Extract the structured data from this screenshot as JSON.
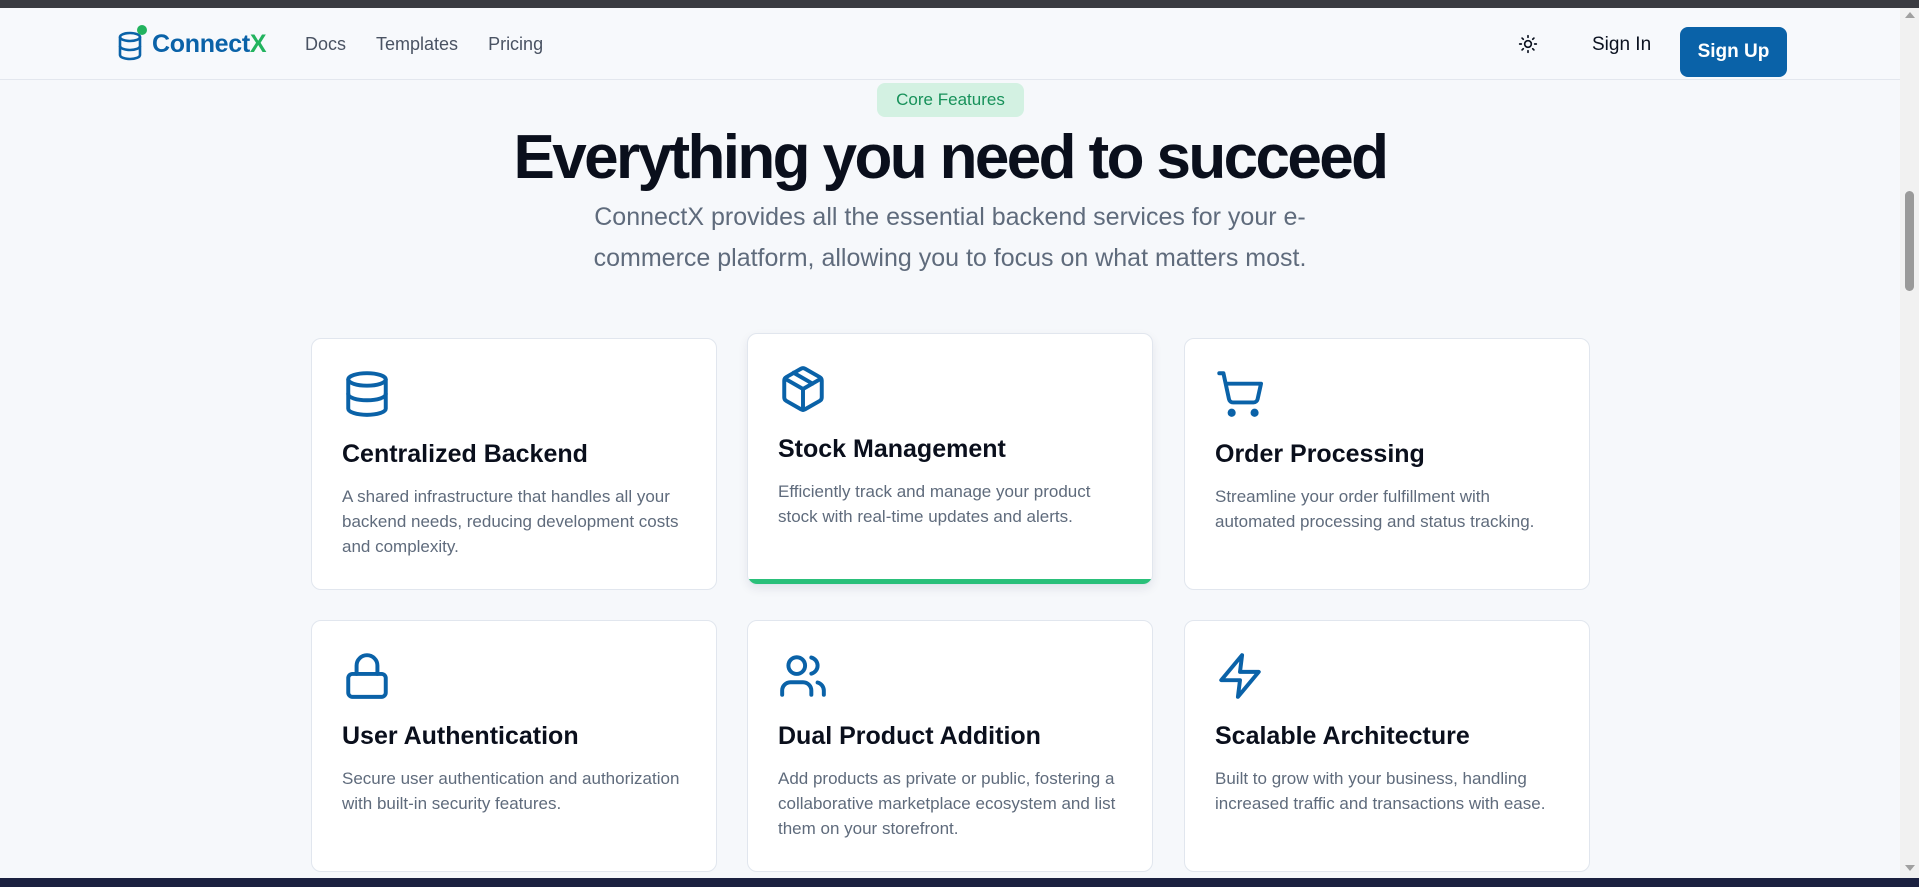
{
  "nav": {
    "brand_part1": "Connect",
    "brand_part2": "X",
    "links": [
      "Docs",
      "Templates",
      "Pricing"
    ],
    "sign_in": "Sign In",
    "sign_up": "Sign Up"
  },
  "hero": {
    "badge": "Core Features",
    "title": "Everything you need to succeed",
    "subtitle": "ConnectX provides all the essential backend services for your e-commerce platform, allowing you to focus on what matters most."
  },
  "features": [
    {
      "icon": "database-icon",
      "title": "Centralized Backend",
      "description": "A shared infrastructure that handles all your backend needs, reducing development costs and complexity."
    },
    {
      "icon": "package-icon",
      "title": "Stock Management",
      "description": "Efficiently track and manage your product stock with real-time updates and alerts."
    },
    {
      "icon": "shopping-cart-icon",
      "title": "Order Processing",
      "description": "Streamline your order fulfillment with automated processing and status tracking."
    },
    {
      "icon": "lock-icon",
      "title": "User Authentication",
      "description": "Secure user authentication and authorization with built-in security features."
    },
    {
      "icon": "users-icon",
      "title": "Dual Product Addition",
      "description": "Add products as private or public, fostering a collaborative marketplace ecosystem and list them on your storefront."
    },
    {
      "icon": "zap-icon",
      "title": "Scalable Architecture",
      "description": "Built to grow with your business, handling increased traffic and transactions with ease."
    }
  ],
  "colors": {
    "primary": "#0a62a8",
    "accent": "#22b35e",
    "badge_bg": "#d3f1e2",
    "active_border": "#2ac07a"
  }
}
